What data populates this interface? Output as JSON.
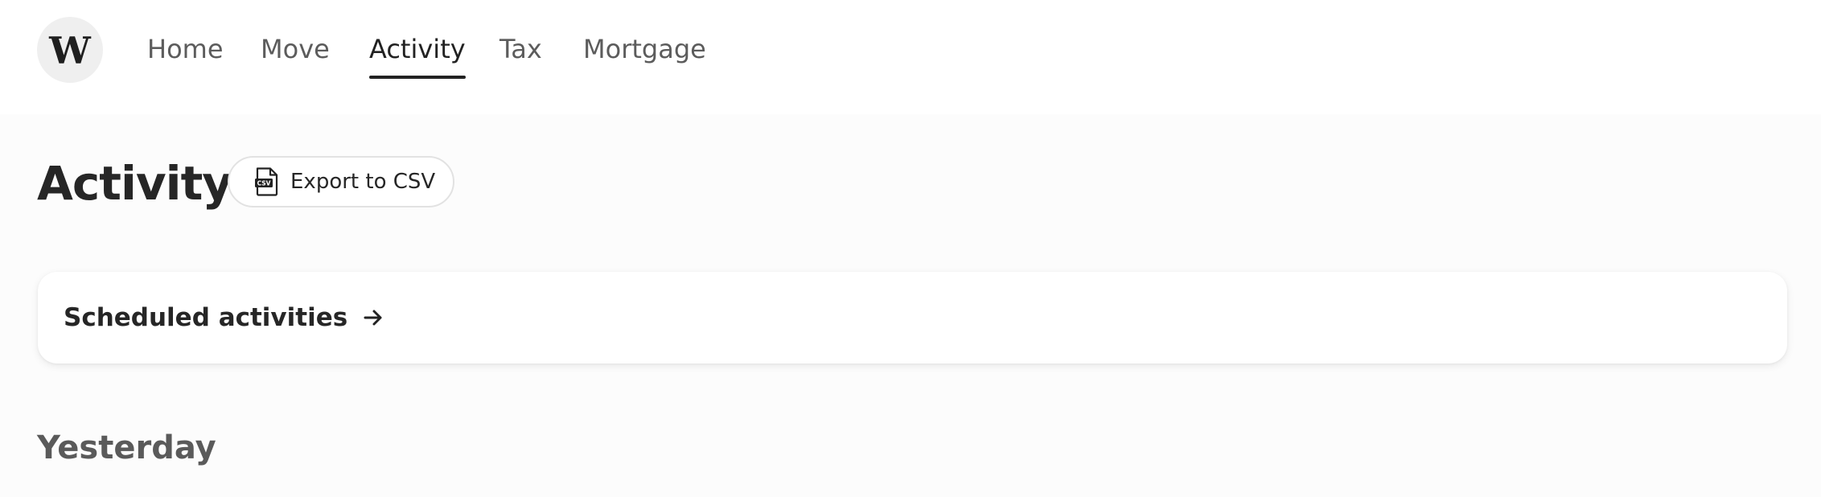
{
  "app": {
    "logo_letter": "W"
  },
  "nav": {
    "items": [
      {
        "label": "Home"
      },
      {
        "label": "Move"
      },
      {
        "label": "Activity",
        "active": true
      },
      {
        "label": "Tax"
      },
      {
        "label": "Mortgage"
      }
    ]
  },
  "header": {
    "title": "Activity",
    "export_label": "Export to CSV",
    "export_icon_text": "CSV"
  },
  "scheduled": {
    "label": "Scheduled activities"
  },
  "sections": [
    {
      "heading": "Yesterday"
    }
  ],
  "icons": {
    "logo": "wealthsimple-w-logo",
    "export": "csv-file-icon",
    "scheduled": "arrow-right-icon"
  },
  "colors": {
    "text_primary": "#222222",
    "text_secondary": "#5c5c5c",
    "background": "#fcfcfc",
    "surface": "#ffffff",
    "logo_bg": "#efefef"
  }
}
